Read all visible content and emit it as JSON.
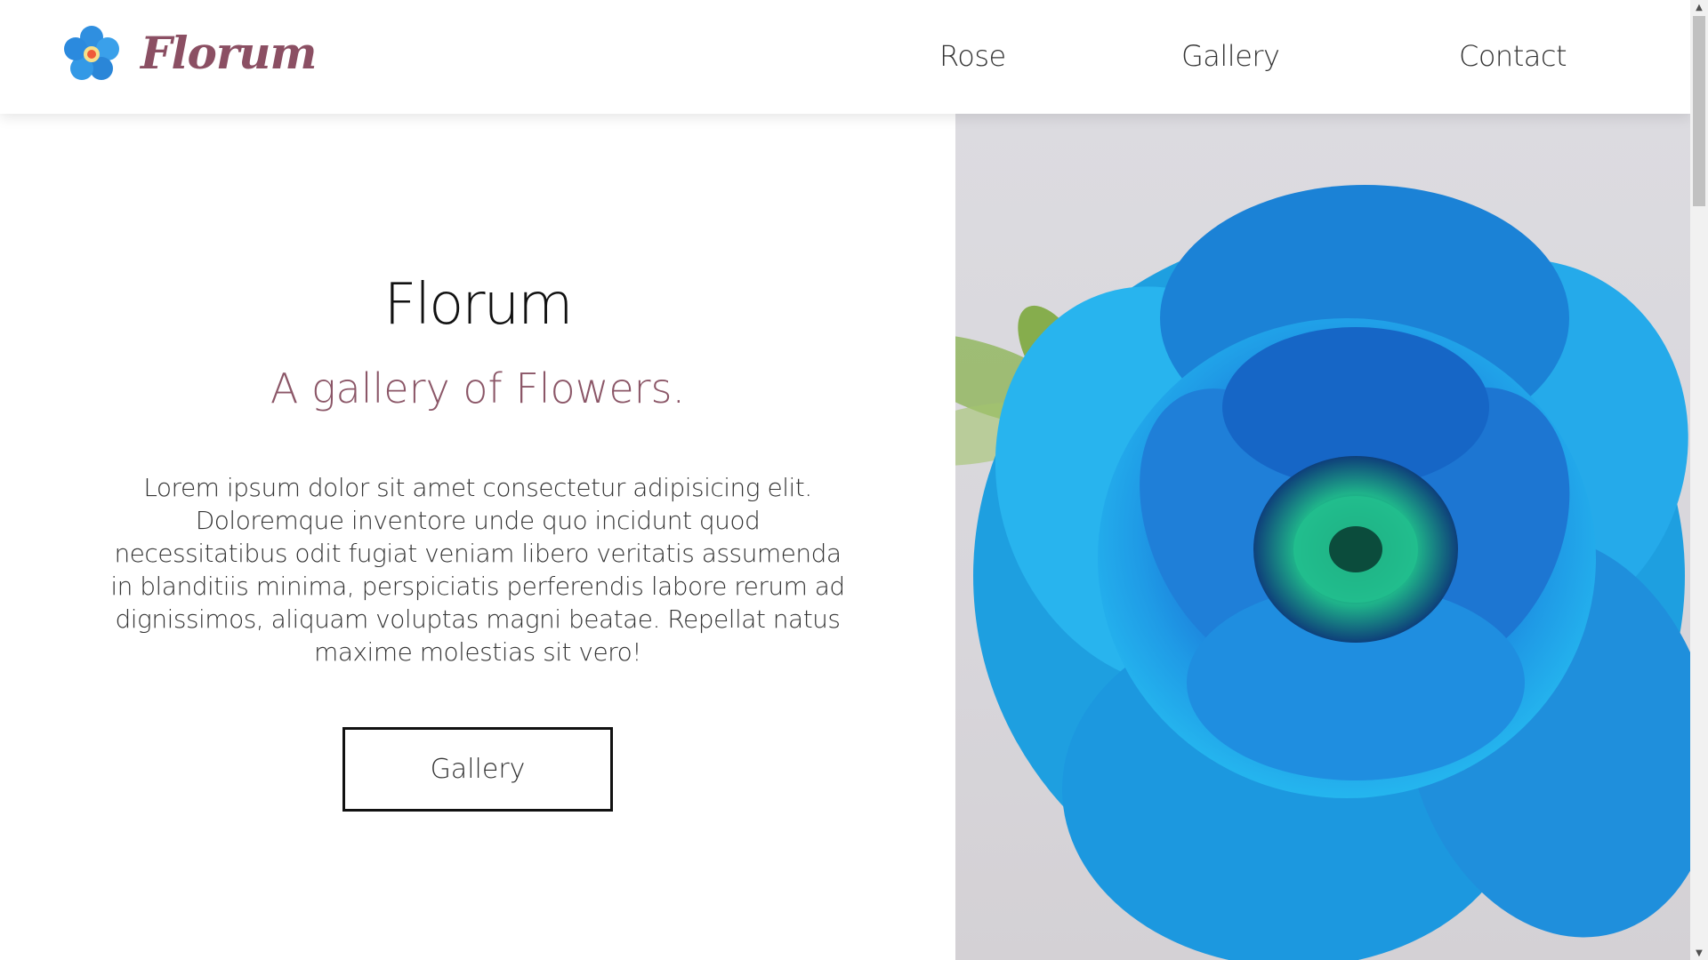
{
  "header": {
    "logo_text": "Florum",
    "nav": [
      {
        "label": "Rose"
      },
      {
        "label": "Gallery"
      },
      {
        "label": "Contact"
      }
    ]
  },
  "hero": {
    "title": "Florum",
    "subtitle": "A gallery of Flowers.",
    "body": "Lorem ipsum dolor sit amet consectetur adipisicing elit. Doloremque inventore unde quo incidunt quod necessitatibus odit fugiat veniam libero veritatis assumenda in blanditiis minima, perspiciatis perferendis labore rerum ad dignissimos, aliquam voluptas magni beatae. Repellat natus maxime molestias sit vero!",
    "button_label": "Gallery"
  },
  "icons": {
    "logo": "flower-logo-icon",
    "scroll_up": "chevron-up-icon",
    "scroll_down": "chevron-down-icon"
  },
  "colors": {
    "brand": "#8b4f63",
    "subtitle": "#8b5667",
    "flower_blue": "#1e9fe0",
    "flower_center": "#1fb38a"
  }
}
